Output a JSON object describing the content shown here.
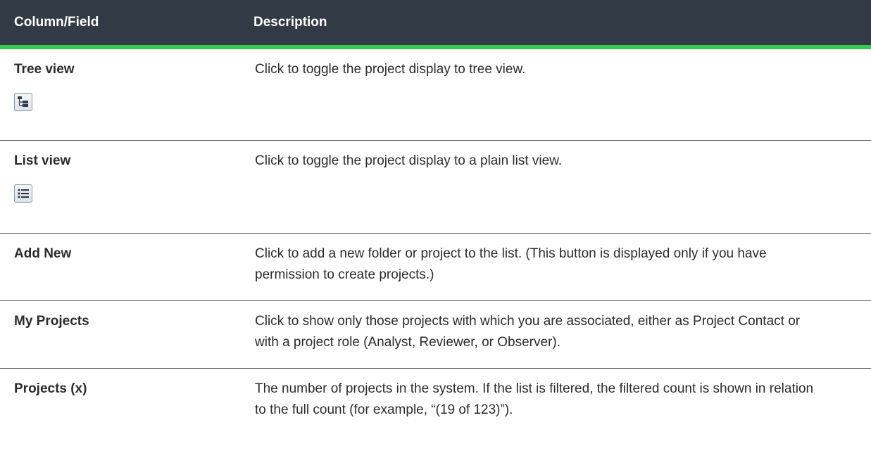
{
  "header": {
    "col_field": "Column/Field",
    "col_desc": "Description"
  },
  "rows": [
    {
      "field": "Tree view",
      "icon": "tree-view-icon",
      "description": "Click to toggle the project display to tree view."
    },
    {
      "field": "List view",
      "icon": "list-view-icon",
      "description": "Click to toggle the project display to a plain list view."
    },
    {
      "field": "Add New",
      "description": "Click to add a new folder or project to the list. (This button is displayed only if you have permission to create projects.)"
    },
    {
      "field": "My Projects",
      "description": "Click to show only those projects with which you are associated, either as Project Contact or with a project role (Analyst, Reviewer, or Observer)."
    },
    {
      "field": "Projects (x)",
      "description": "The number of projects in the system. If the list is filtered, the filtered count is shown in relation to the full count (for example, “(19 of 123)”)."
    }
  ],
  "colors": {
    "header_bg": "#323b45",
    "header_accent": "#36c94b",
    "text": "#2b2b2b"
  }
}
